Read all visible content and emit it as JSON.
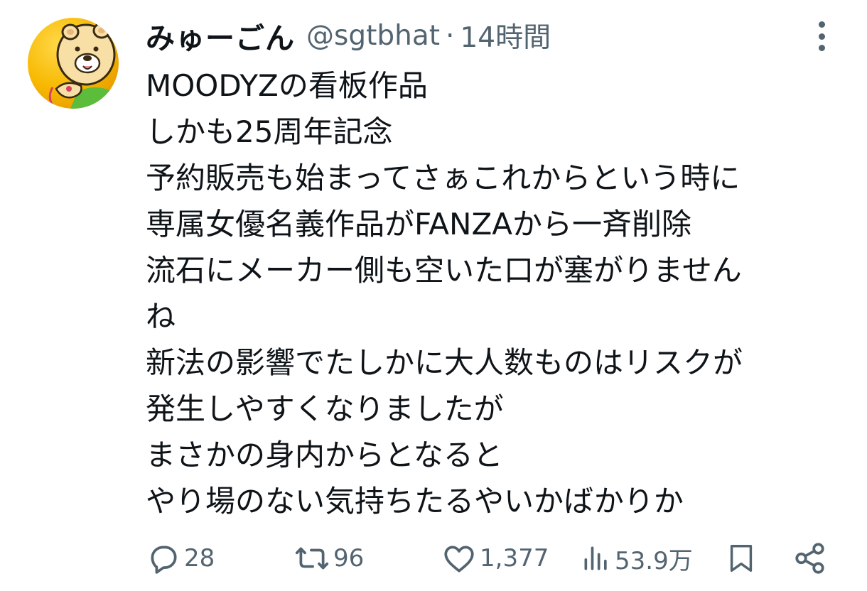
{
  "user": {
    "display_name": "みゅーごん",
    "handle": "@sgtbhat",
    "separator": "·",
    "time": "14時間"
  },
  "tweet": {
    "lines": [
      "MOODYZの看板作品",
      "しかも25周年記念",
      "予約販売も始まってさぁこれからという時に",
      "専属女優名義作品がFANZAから一斉削除",
      "流石にメーカー側も空いた口が塞がりません",
      "ね",
      "新法の影響でたしかに大人数ものはリスクが",
      "発生しやすくなりましたが",
      "まさかの身内からとなると",
      "やり場のない気持ちたるやいかばかりか"
    ]
  },
  "actions": {
    "reply_count": "28",
    "retweet_count": "96",
    "like_count": "1,377",
    "view_count": "53.9万"
  },
  "icons": {
    "avatar": "bear-avatar",
    "more": "more-vertical-icon",
    "reply": "reply-icon",
    "retweet": "retweet-icon",
    "like": "heart-icon",
    "views": "views-icon",
    "bookmark": "bookmark-icon",
    "share": "share-icon"
  },
  "colors": {
    "text": "#0f1419",
    "secondary": "#536471",
    "background": "#ffffff"
  }
}
